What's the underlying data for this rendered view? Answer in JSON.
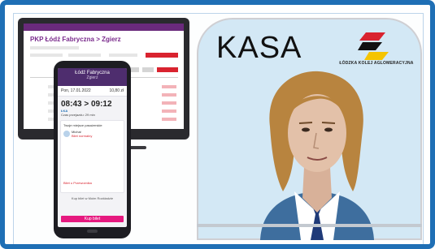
{
  "monitor": {
    "topbar_text": "",
    "title": "PKP Łódź Fabryczna > Zgierz"
  },
  "phone": {
    "header_line1": "Łódź Fabryczna",
    "header_line2": "Zgierz",
    "sub_date": "Pon, 17.01.2022",
    "sub_price": "10,80 zł",
    "time_range": "08:43 > 09:12",
    "train_line": "ŁKA",
    "travel_time": "Czas przejazdu: 29 min",
    "card_title": "Twoje miejsce pasażerskie",
    "passenger_name": "Michał",
    "ticket_tag": "Bilet normalny",
    "status_pill": "Bilet u Przewoźnika",
    "link_text": "Kup bilet w Moim Rozkładzie",
    "cta_label": "Kup bilet"
  },
  "kasa": {
    "title": "KASA",
    "logo_text": "ŁÓDZKA KOLEJ AGLOMERACYJNA"
  },
  "colors": {
    "frame_border": "#1f6fb5",
    "booth_bg": "#d3e8f5",
    "brand_purple": "#4e2d6e",
    "brand_pink": "#e6197f",
    "lka_red": "#d9232f",
    "lka_yellow": "#f5c400"
  }
}
